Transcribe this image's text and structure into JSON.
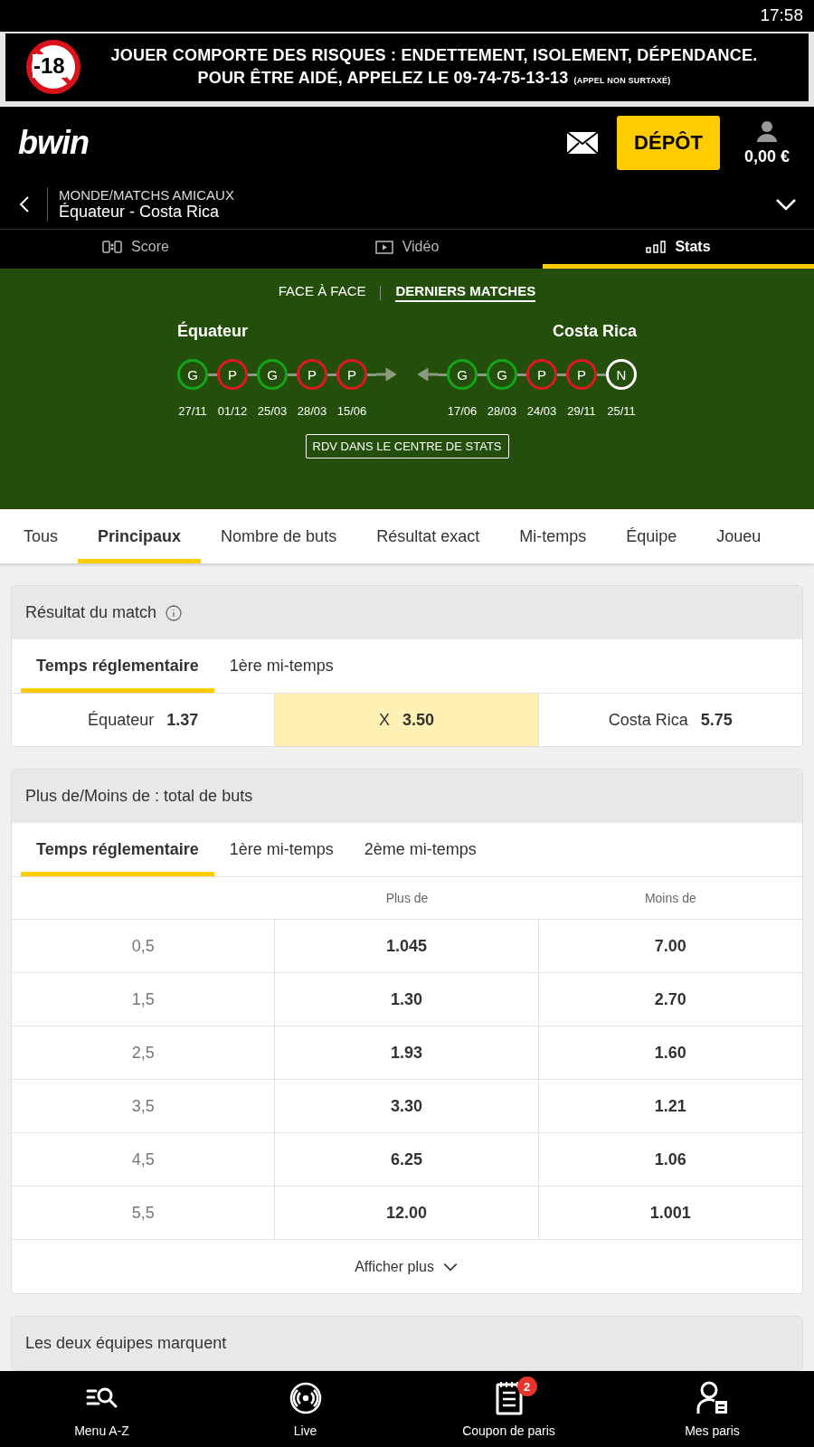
{
  "status_bar": {
    "time": "17:58"
  },
  "warning_banner": {
    "age_badge": "-18",
    "line_1": "JOUER COMPORTE DES RISQUES : ENDETTEMENT, ISOLEMENT, DÉPENDANCE.",
    "line_2": "POUR ÊTRE AIDÉ, APPELEZ LE 09-74-75-13-13",
    "line_2_note": "(APPEL NON SURTAXÉ)"
  },
  "header": {
    "logo": "bwin",
    "deposit_button": "DÉPÔT",
    "balance": "0,00 €"
  },
  "breadcrumb": {
    "category": "MONDE/MATCHS AMICAUX",
    "event": "Équateur - Costa Rica"
  },
  "view_tabs": [
    {
      "label": "Score",
      "selected": false
    },
    {
      "label": "Vidéo",
      "selected": false
    },
    {
      "label": "Stats",
      "selected": true
    }
  ],
  "stats": {
    "tabs": [
      {
        "label": "FACE À FACE",
        "selected": false
      },
      {
        "label": "DERNIERS MATCHES",
        "selected": true
      }
    ],
    "teams": [
      {
        "name": "Équateur",
        "matches": [
          {
            "result": "G",
            "color": "#14a519",
            "date": "27/11"
          },
          {
            "result": "P",
            "color": "#e0181f",
            "date": "01/12"
          },
          {
            "result": "G",
            "color": "#14a519",
            "date": "25/03"
          },
          {
            "result": "P",
            "color": "#e0181f",
            "date": "28/03"
          },
          {
            "result": "P",
            "color": "#e0181f",
            "date": "15/06"
          }
        ]
      },
      {
        "name": "Costa Rica",
        "matches": [
          {
            "result": "G",
            "color": "#14a519",
            "date": "17/06"
          },
          {
            "result": "G",
            "color": "#14a519",
            "date": "28/03"
          },
          {
            "result": "P",
            "color": "#e0181f",
            "date": "24/03"
          },
          {
            "result": "P",
            "color": "#e0181f",
            "date": "29/11"
          },
          {
            "result": "N",
            "color": "#ffffff",
            "date": "25/11"
          }
        ]
      }
    ],
    "stats_center_button": "RDV DANS LE CENTRE DE STATS"
  },
  "market_tabs": [
    {
      "label": "Tous",
      "selected": false
    },
    {
      "label": "Principaux",
      "selected": true
    },
    {
      "label": "Nombre de buts",
      "selected": false
    },
    {
      "label": "Résultat exact",
      "selected": false
    },
    {
      "label": "Mi-temps",
      "selected": false
    },
    {
      "label": "Équipe",
      "selected": false
    },
    {
      "label": "Joueu",
      "selected": false
    }
  ],
  "markets": [
    {
      "kind": "three_way",
      "title": "Résultat du match",
      "periods": [
        {
          "label": "Temps réglementaire",
          "selected": true
        },
        {
          "label": "1ère mi-temps",
          "selected": false
        }
      ],
      "outcomes": [
        {
          "name": "Équateur",
          "odds": "1.37",
          "selected": false
        },
        {
          "name": "X",
          "odds": "3.50",
          "selected": true
        },
        {
          "name": "Costa Rica",
          "odds": "5.75",
          "selected": false
        }
      ]
    },
    {
      "kind": "over_under",
      "title": "Plus de/Moins de : total de buts",
      "periods": [
        {
          "label": "Temps réglementaire",
          "selected": true
        },
        {
          "label": "1ère mi-temps",
          "selected": false
        },
        {
          "label": "2ème mi-temps",
          "selected": false
        }
      ],
      "columns": [
        "Plus de",
        "Moins de"
      ],
      "rows": [
        {
          "line": "0,5",
          "over": "1.045",
          "under": "7.00"
        },
        {
          "line": "1,5",
          "over": "1.30",
          "under": "2.70"
        },
        {
          "line": "2,5",
          "over": "1.93",
          "under": "1.60"
        },
        {
          "line": "3,5",
          "over": "3.30",
          "under": "1.21"
        },
        {
          "line": "4,5",
          "over": "6.25",
          "under": "1.06"
        },
        {
          "line": "5,5",
          "over": "12.00",
          "under": "1.001"
        }
      ],
      "show_more": "Afficher plus"
    },
    {
      "kind": "collapsed",
      "title": "Les deux équipes marquent"
    }
  ],
  "bottom_nav": [
    {
      "label": "Menu A-Z"
    },
    {
      "label": "Live"
    },
    {
      "label": "Coupon de paris",
      "badge": "2"
    },
    {
      "label": "Mes paris"
    }
  ]
}
